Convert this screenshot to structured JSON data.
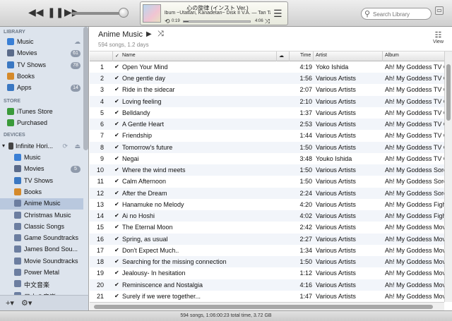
{
  "toolbar": {
    "prev_icon": "◀◀",
    "pause_icon": "❚❚",
    "next_icon": "▶▶",
    "now_playing": {
      "title": "心の旋律 (インスト Ver.)",
      "subtitle": "lbum ~Utattari, Kanadetari~ Disk II  V.A. — Tari Tari",
      "elapsed": "0:19",
      "remaining": "4:06",
      "progress": 0.07
    },
    "search_placeholder": "Search Library"
  },
  "sidebar": {
    "library_header": "LIBRARY",
    "library": [
      {
        "label": "Music",
        "icon": "note-icon",
        "color": "#3a7fd5",
        "extra": "cloud"
      },
      {
        "label": "Movies",
        "icon": "film-icon",
        "color": "#5b6b8a",
        "badge": "61"
      },
      {
        "label": "TV Shows",
        "icon": "tv-icon",
        "color": "#3b78c2",
        "badge": "78"
      },
      {
        "label": "Books",
        "icon": "book-icon",
        "color": "#d58a2b"
      },
      {
        "label": "Apps",
        "icon": "apps-icon",
        "color": "#3b78c2",
        "badge": "14"
      }
    ],
    "store_header": "STORE",
    "store": [
      {
        "label": "iTunes Store",
        "icon": "store-icon",
        "color": "#3a9a3a"
      },
      {
        "label": "Purchased",
        "icon": "purchased-icon",
        "color": "#3a9a3a"
      }
    ],
    "devices_header": "DEVICES",
    "device": {
      "label": "Infinite Hori...",
      "icon": "ipod-icon"
    },
    "device_items": [
      {
        "label": "Music",
        "icon": "note-icon",
        "color": "#3a7fd5"
      },
      {
        "label": "Movies",
        "icon": "film-icon",
        "color": "#5b6b8a",
        "badge": "5"
      },
      {
        "label": "TV Shows",
        "icon": "tv-icon",
        "color": "#3b78c2"
      },
      {
        "label": "Books",
        "icon": "book-icon",
        "color": "#d58a2b"
      },
      {
        "label": "Anime Music",
        "icon": "playlist-icon",
        "color": "#6c7ea0"
      },
      {
        "label": "Christmas Music",
        "icon": "playlist-icon",
        "color": "#6c7ea0"
      },
      {
        "label": "Classic Songs",
        "icon": "playlist-icon",
        "color": "#6c7ea0"
      },
      {
        "label": "Game Soundtracks",
        "icon": "playlist-icon",
        "color": "#6c7ea0"
      },
      {
        "label": "James Bond Sou...",
        "icon": "playlist-icon",
        "color": "#6c7ea0"
      },
      {
        "label": "Movie Soundtracks",
        "icon": "playlist-icon",
        "color": "#6c7ea0"
      },
      {
        "label": "Power Metal",
        "icon": "playlist-icon",
        "color": "#6c7ea0"
      },
      {
        "label": "中文音楽",
        "icon": "playlist-icon",
        "color": "#6c7ea0"
      },
      {
        "label": "日本の音楽",
        "icon": "playlist-icon",
        "color": "#6c7ea0"
      }
    ]
  },
  "main": {
    "title": "Anime Music",
    "subtitle": "594 songs, 1.2 days",
    "view_label": "View",
    "columns": {
      "name": "Name",
      "time": "Time",
      "artist": "Artist",
      "album": "Album"
    },
    "rows": [
      {
        "num": "1",
        "name": "Open Your Mind",
        "time": "4:19",
        "artist": "Yoko Ishida",
        "album": "Ah! My Goddess TV O"
      },
      {
        "num": "2",
        "name": "One gentle day",
        "time": "1:56",
        "artist": "Various Artists",
        "album": "Ah! My Goddess TV O"
      },
      {
        "num": "3",
        "name": "Ride in the sidecar",
        "time": "2:07",
        "artist": "Various Artists",
        "album": "Ah! My Goddess TV O"
      },
      {
        "num": "4",
        "name": "Loving feeling",
        "time": "2:10",
        "artist": "Various Artists",
        "album": "Ah! My Goddess TV O"
      },
      {
        "num": "5",
        "name": "Belldandy",
        "time": "1:37",
        "artist": "Various Artists",
        "album": "Ah! My Goddess TV O"
      },
      {
        "num": "6",
        "name": "A Gentle Heart",
        "time": "2:53",
        "artist": "Various Artists",
        "album": "Ah! My Goddess TV O"
      },
      {
        "num": "7",
        "name": "Friendship",
        "time": "1:44",
        "artist": "Various Artists",
        "album": "Ah! My Goddess TV O"
      },
      {
        "num": "8",
        "name": "Tomorrow's future",
        "time": "1:50",
        "artist": "Various Artists",
        "album": "Ah! My Goddess TV O"
      },
      {
        "num": "9",
        "name": "Negai",
        "time": "3:48",
        "artist": "Youko Ishida",
        "album": "Ah! My Goddess TV O"
      },
      {
        "num": "10",
        "name": "Where the wind meets",
        "time": "1:50",
        "artist": "Various Artists",
        "album": "Ah! My Goddess Sore"
      },
      {
        "num": "11",
        "name": "Calm Afternoon",
        "time": "1:50",
        "artist": "Various Artists",
        "album": "Ah! My Goddess Sore"
      },
      {
        "num": "12",
        "name": "After the Dream",
        "time": "2:24",
        "artist": "Various Artists",
        "album": "Ah! My Goddess Sore"
      },
      {
        "num": "13",
        "name": "Hanamuke no Melody",
        "time": "4:20",
        "artist": "Various Artists",
        "album": "Ah! My Goddess Figh"
      },
      {
        "num": "14",
        "name": "Ai no Hoshi",
        "time": "4:02",
        "artist": "Various Artists",
        "album": "Ah! My Goddess Figh"
      },
      {
        "num": "15",
        "name": "The Eternal Moon",
        "time": "2:42",
        "artist": "Various Artists",
        "album": "Ah! My Goddess Mov"
      },
      {
        "num": "16",
        "name": "Spring, as usual",
        "time": "2:27",
        "artist": "Various Artists",
        "album": "Ah! My Goddess Mov"
      },
      {
        "num": "17",
        "name": "Don't Expect Much..",
        "time": "1:34",
        "artist": "Various Artists",
        "album": "Ah! My Goddess Mov"
      },
      {
        "num": "18",
        "name": "Searching for the missing connection",
        "time": "1:50",
        "artist": "Various Artists",
        "album": "Ah! My Goddess Mov"
      },
      {
        "num": "19",
        "name": "Jealousy- In hesitation",
        "time": "1:12",
        "artist": "Various Artists",
        "album": "Ah! My Goddess Mov"
      },
      {
        "num": "20",
        "name": "Reminiscence and Nostalgia",
        "time": "4:16",
        "artist": "Various Artists",
        "album": "Ah! My Goddess Mov"
      },
      {
        "num": "21",
        "name": "Surely if we were together...",
        "time": "1:47",
        "artist": "Various Artists",
        "album": "Ah! My Goddess Mov"
      }
    ]
  },
  "status_bar": "594 songs, 1:06:00:23 total time, 3.72 GB"
}
